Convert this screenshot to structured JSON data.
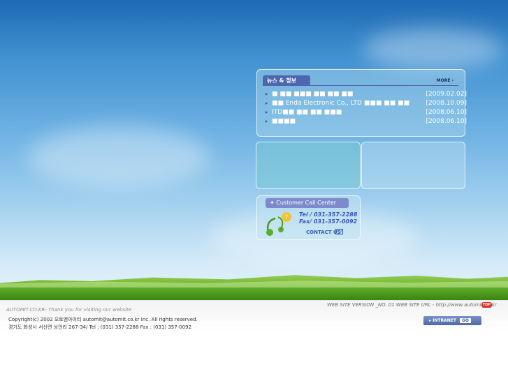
{
  "news": {
    "tab_label": "뉴스 & 정보",
    "more_label": "MORE ›",
    "items": [
      {
        "title": "■ ■■ ■■■ ■■ ■■ ■■",
        "date": "[2009.02.02]"
      },
      {
        "title": "■■  Enda Electronic Co., LTD ■■■ ■■ ■■",
        "date": "[2008.10.09]"
      },
      {
        "title": "ITD■■ ■■ ■■ ■■■",
        "date": "[2008.06.10]"
      },
      {
        "title": "■■■■",
        "date": "[2008.06.10]"
      }
    ]
  },
  "call_center": {
    "title": "✦  Customer Call Center",
    "tel": "Tel /   031-357-2288",
    "fax": "Fax/   031-357-0092",
    "contact_label": "CONTACT US"
  },
  "footer": {
    "thanks": "AUTOMIT.CO.KR- Thank you for visiting our website",
    "version": "WEB SITE  VERSION _NO. 01    WEB SITE URL - http://www.automit.co.kr",
    "top_label": "TOP",
    "copyright": "Copyright(c) 2002 오토엠아이티 automit@automit.co.kr Inc. All rights reserved.",
    "address": "경기도 화성시 서신면 상안리 267-34/ Tel : (031) 357-2288  Fax : (031) 357-0092",
    "intranet_label": "▸ INTRANET",
    "go_label": "GO"
  },
  "colors": {
    "accent": "#4e66b0",
    "sky_top": "#1f69b4",
    "grass": "#4e9d1f"
  }
}
